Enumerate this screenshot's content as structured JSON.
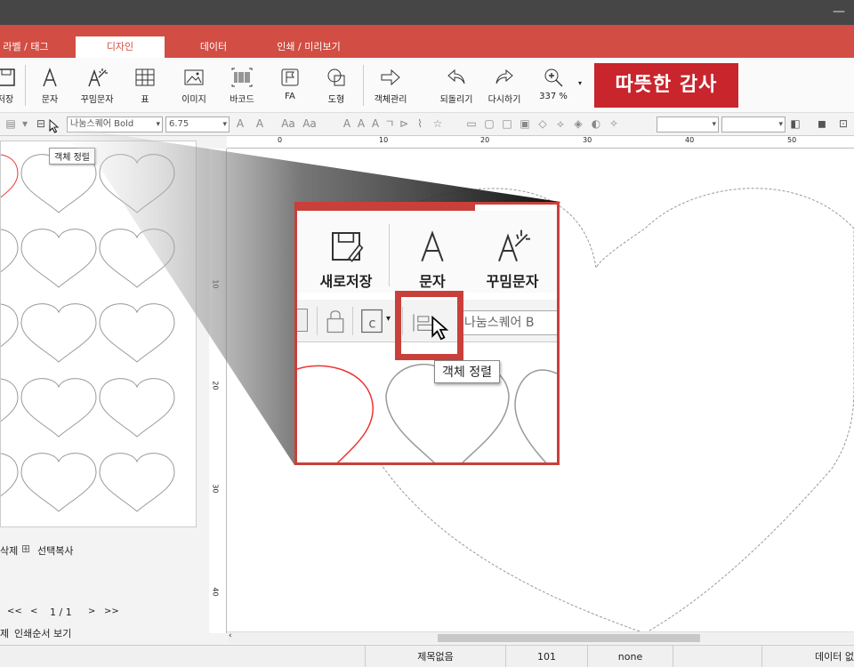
{
  "menu": {
    "tabs": [
      {
        "label": "라벨 / 태그"
      },
      {
        "label": "디자인"
      },
      {
        "label": "데이터"
      },
      {
        "label": "인쇄 / 미리보기"
      }
    ]
  },
  "ribbon": {
    "save_partial": "저장",
    "text": "문자",
    "fancy_text": "꾸밈문자",
    "table": "표",
    "image": "이미지",
    "barcode": "바코드",
    "fa": "FA",
    "shape": "도형",
    "object_manage": "객체관리",
    "undo": "되돌리기",
    "redo": "다시하기",
    "zoom": "337 %",
    "banner": "따뜻한 감사"
  },
  "format": {
    "font": "나눔스퀘어 Bold",
    "size": "6.75"
  },
  "tooltip": "객체 정렬",
  "ruler": {
    "h": [
      "0",
      "10",
      "20",
      "30",
      "40",
      "50"
    ],
    "v": [
      "10",
      "20",
      "30",
      "40"
    ]
  },
  "left_panel": {
    "delete_partial": "삭제",
    "copy_select": "선택복사",
    "pager": {
      "first": "<<",
      "prev": "<",
      "page": "1 / 1",
      "next": ">",
      "last": ">>"
    },
    "bottom_partial": "제",
    "print_order": "인쇄순서 보기"
  },
  "zoom_callout": {
    "save_new": "새로저장",
    "text": "문자",
    "fancy_text": "꾸밈문자",
    "font_partial": "나눔스퀘어 B",
    "tooltip": "객체 정렬"
  },
  "status": {
    "title": "제목없음",
    "count": "101",
    "mode": "none",
    "data_partial": "데이터 없"
  },
  "colors": {
    "accent": "#d24d43",
    "title_bar": "#464646",
    "highlight": "#c9403a"
  }
}
